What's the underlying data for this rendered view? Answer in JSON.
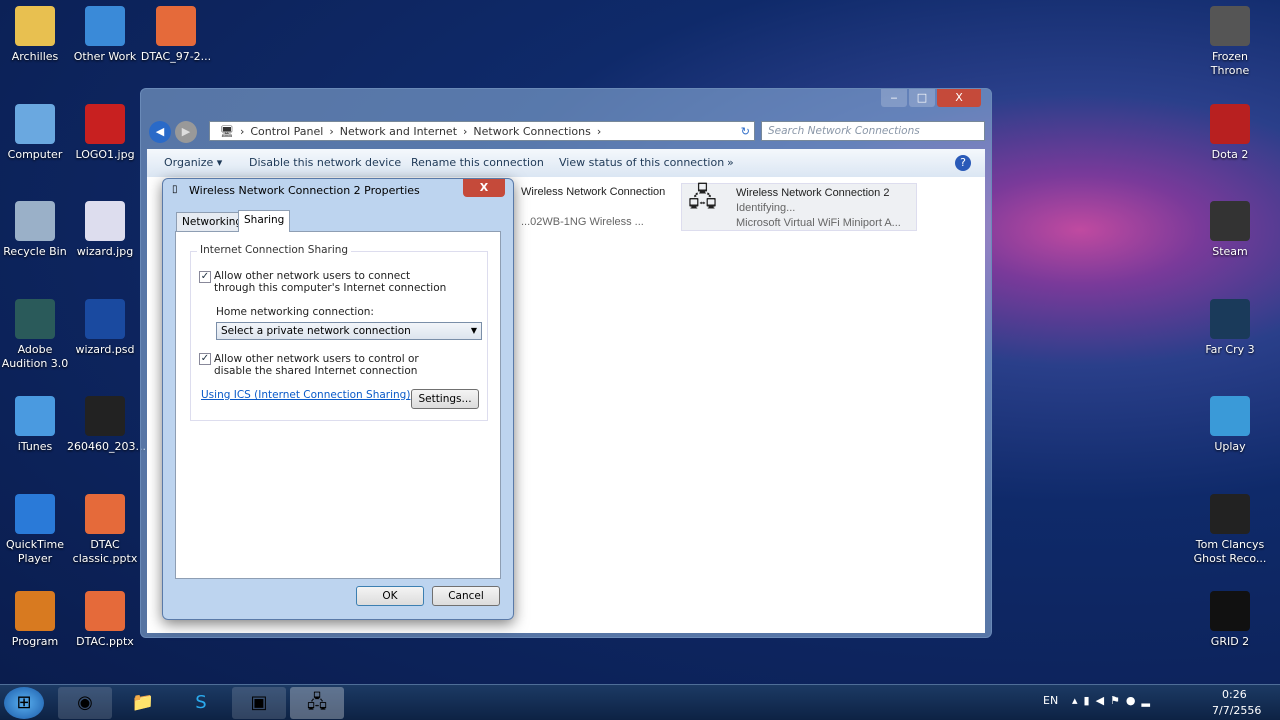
{
  "desktop_left": [
    {
      "label": "Archilles",
      "color": "#e8c050"
    },
    {
      "label": "Other Work",
      "color": "#3a8ad8"
    },
    {
      "label": "DTAC_97-2...",
      "color": "#e56a3a"
    },
    {
      "label": "Computer",
      "color": "#6aa8e0"
    },
    {
      "label": "LOGO1.jpg",
      "color": "#c82020"
    },
    {
      "label": "Recycle Bin",
      "color": "#9ab0c8"
    },
    {
      "label": "wizard.jpg",
      "color": "#dde"
    },
    {
      "label": "Adobe Audition 3.0",
      "color": "#2a5a5a"
    },
    {
      "label": "wizard.psd",
      "color": "#1a4aa0"
    },
    {
      "label": "iTunes",
      "color": "#4a9ae0"
    },
    {
      "label": "260460_203...",
      "color": "#222"
    },
    {
      "label": "QuickTime Player",
      "color": "#2a7ad8"
    },
    {
      "label": "DTAC classic.pptx",
      "color": "#e56a3a"
    },
    {
      "label": "Program",
      "color": "#d87a20"
    },
    {
      "label": "DTAC.pptx",
      "color": "#e56a3a"
    }
  ],
  "desktop_right": [
    {
      "label": "Frozen Throne",
      "color": "#555"
    },
    {
      "label": "Dota 2",
      "color": "#b82020"
    },
    {
      "label": "Steam",
      "color": "#333"
    },
    {
      "label": "Far Cry 3",
      "color": "#1a3a5a"
    },
    {
      "label": "Uplay",
      "color": "#3a9ad8"
    },
    {
      "label": "Tom Clancys Ghost Reco...",
      "color": "#222"
    },
    {
      "label": "GRID 2",
      "color": "#111"
    }
  ],
  "explorer": {
    "controls": [
      "‒",
      "□",
      "X"
    ],
    "breadcrumb": [
      "Control Panel",
      "Network and Internet",
      "Network Connections"
    ],
    "search_placeholder": "Search Network Connections",
    "toolbar": [
      "Organize ▾",
      "Disable this network device",
      "Rename this connection",
      "View status of this connection",
      "»"
    ],
    "connections": [
      {
        "name": "Wireless Network Connection",
        "detail": "...02WB-1NG Wireless ..."
      },
      {
        "name": "Wireless Network Connection 2",
        "status": "Identifying...",
        "detail": "Microsoft Virtual WiFi Miniport A..."
      }
    ]
  },
  "dialog": {
    "title": "Wireless Network Connection 2 Properties",
    "close": "X",
    "tabs": [
      "Networking",
      "Sharing"
    ],
    "active_tab": "Sharing",
    "group_label": "Internet Connection Sharing",
    "allow_connect": {
      "label": "Allow other network users to connect through this computer's Internet connection",
      "checked": true
    },
    "home_label": "Home networking connection:",
    "home_select": "Select a private network connection",
    "allow_control": {
      "label": "Allow other network users to control or disable the shared Internet connection",
      "checked": true
    },
    "link": "Using ICS (Internet Connection Sharing)",
    "settings": "Settings...",
    "ok": "OK",
    "cancel": "Cancel"
  },
  "taskbar": {
    "lang": "EN",
    "time": "0:26",
    "date": "7/7/2556"
  }
}
